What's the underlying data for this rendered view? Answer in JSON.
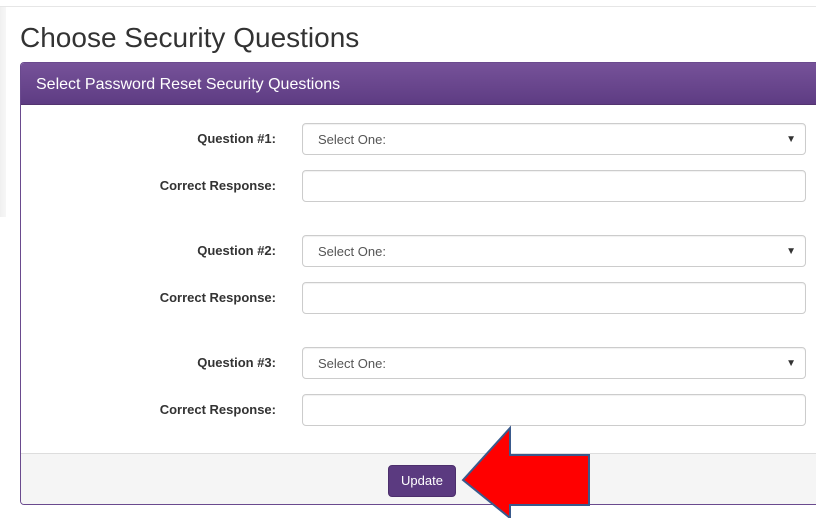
{
  "page": {
    "title": "Choose Security Questions"
  },
  "panel": {
    "title": "Select Password Reset Security Questions",
    "questions": [
      {
        "question_label": "Question #1:",
        "select_value": "Select One:",
        "response_label": "Correct Response:",
        "response_value": ""
      },
      {
        "question_label": "Question #2:",
        "select_value": "Select One:",
        "response_label": "Correct Response:",
        "response_value": ""
      },
      {
        "question_label": "Question #3:",
        "select_value": "Select One:",
        "response_label": "Correct Response:",
        "response_value": ""
      }
    ],
    "caret_glyph": "▼",
    "footer": {
      "update_label": "Update"
    }
  },
  "icons": {
    "dropdown": "chevron-down-icon",
    "annotation": "red-arrow-icon"
  },
  "colors": {
    "header_purple": "#5e3c83",
    "button_purple": "#5b3a80",
    "arrow_red": "#ff0000",
    "arrow_outline": "#3a5a8c"
  }
}
